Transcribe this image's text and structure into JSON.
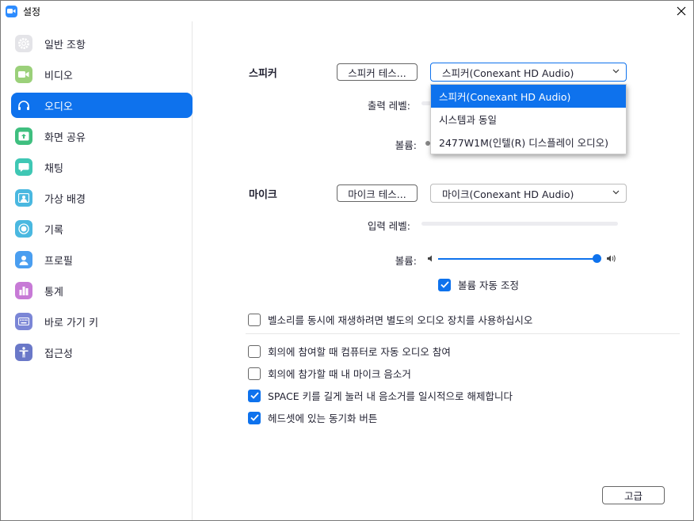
{
  "window": {
    "title": "설정"
  },
  "colors": {
    "accent": "#0e72ed"
  },
  "sidebar": {
    "items": [
      {
        "label": "일반 조항",
        "icon": "gear-icon",
        "color": "#e4e4e8"
      },
      {
        "label": "비디오",
        "icon": "video-camera-icon",
        "color": "#9bd07a"
      },
      {
        "label": "오디오",
        "icon": "headphones-icon",
        "color": "#0e72ed",
        "active": true
      },
      {
        "label": "화면 공유",
        "icon": "share-screen-icon",
        "color": "#3fbf7f"
      },
      {
        "label": "채팅",
        "icon": "chat-bubble-icon",
        "color": "#3fc7b4"
      },
      {
        "label": "가상 배경",
        "icon": "virtual-background-icon",
        "color": "#4ab8e0"
      },
      {
        "label": "기록",
        "icon": "record-icon",
        "color": "#4ab8e0"
      },
      {
        "label": "프로필",
        "icon": "profile-icon",
        "color": "#4a9ef0"
      },
      {
        "label": "통계",
        "icon": "statistics-icon",
        "color": "#c77ad6"
      },
      {
        "label": "바로 가기 키",
        "icon": "keyboard-icon",
        "color": "#7b86d6"
      },
      {
        "label": "접근성",
        "icon": "accessibility-icon",
        "color": "#6a78c8"
      }
    ]
  },
  "speaker": {
    "section_label": "스피커",
    "test_button": "스피커 테스...",
    "device": "스피커(Conexant HD Audio)",
    "output_level_label": "출력 레벨:",
    "volume_label": "볼륨:",
    "dropdown_options": [
      "스피커(Conexant HD Audio)",
      "시스템과 동일",
      "2477W1M(인텔(R) 디스플레이 오디오)"
    ]
  },
  "mic": {
    "section_label": "마이크",
    "test_button": "마이크 테스...",
    "device": "마이크(Conexant HD Audio)",
    "input_level_label": "입력 레벨:",
    "volume_label": "볼륨:",
    "volume": 1.0,
    "auto_adjust_label": "볼륨 자동 조정",
    "auto_adjust": true
  },
  "options": {
    "ring_separate": {
      "label": "벨소리를 동시에 재생하려면 별도의 오디오 장치를 사용하십시오",
      "checked": false
    },
    "auto_join_audio": {
      "label": "회의에 참여할 때 컴퓨터로 자동 오디오 참여",
      "checked": false
    },
    "mute_on_join": {
      "label": "회의에 참가할 때 내 마이크 음소거",
      "checked": false
    },
    "space_unmute": {
      "label": "SPACE 키를 길게 눌러 내 음소거를 일시적으로 해제합니다",
      "checked": true
    },
    "headset_sync": {
      "label": "헤드셋에 있는 동기화 버튼",
      "checked": true
    }
  },
  "advanced_button": "고급"
}
